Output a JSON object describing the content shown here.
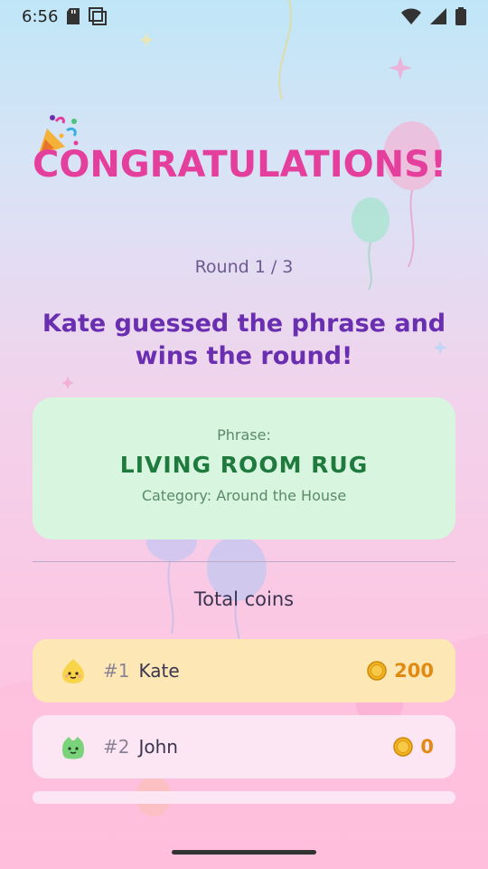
{
  "status_bar": {
    "time": "6:56"
  },
  "title": "CONGRATULATIONS!",
  "round_text": "Round 1 / 3",
  "headline": "Kate guessed the phrase and wins the round!",
  "phrase_card": {
    "label": "Phrase:",
    "phrase": "LIVING ROOM RUG",
    "category": "Category: Around the House"
  },
  "total_coins_label": "Total coins",
  "players": [
    {
      "rank": "#1",
      "name": "Kate",
      "coins": "200",
      "avatar": "yellow-blob-avatar"
    },
    {
      "rank": "#2",
      "name": "John",
      "coins": "0",
      "avatar": "green-blob-avatar"
    }
  ],
  "colors": {
    "title": "#e43f9c",
    "headline": "#6a2fb0",
    "phrase_card_bg": "#d8f5df",
    "phrase_text": "#1f7a3e",
    "first_place_row": "#fde7b5",
    "other_row": "#fde6f3",
    "coin_amount": "#e08a12"
  }
}
